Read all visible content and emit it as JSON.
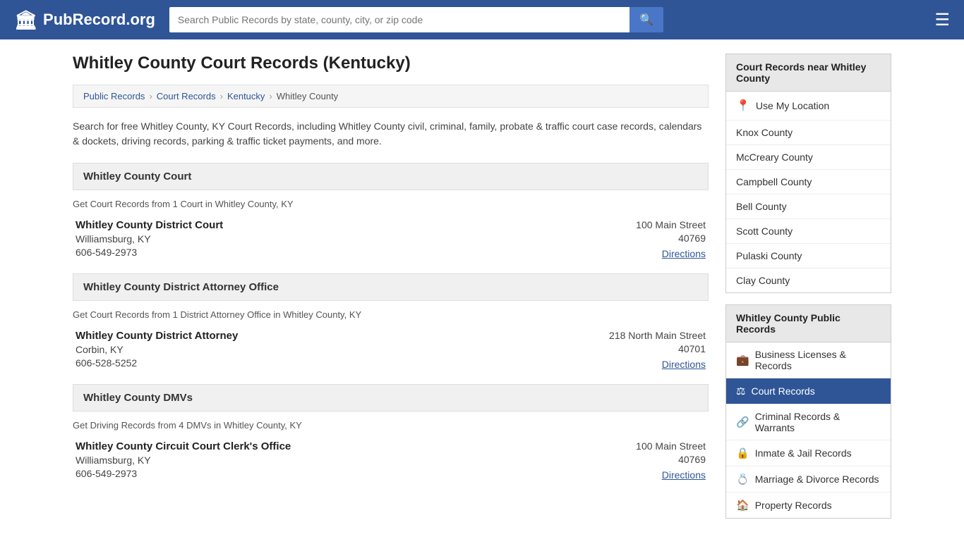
{
  "header": {
    "logo_icon": "🏛",
    "logo_text": "PubRecord.org",
    "search_placeholder": "Search Public Records by state, county, city, or zip code",
    "search_icon": "🔍",
    "menu_icon": "☰"
  },
  "page": {
    "title": "Whitley County Court Records (Kentucky)",
    "breadcrumbs": [
      "Public Records",
      "Court Records",
      "Kentucky",
      "Whitley County"
    ],
    "intro": "Search for free Whitley County, KY Court Records, including Whitley County civil, criminal, family, probate & traffic court case records, calendars & dockets, driving records, parking & traffic ticket payments, and more."
  },
  "sections": [
    {
      "id": "court",
      "header": "Whitley County Court",
      "desc": "Get Court Records from 1 Court in Whitley County, KY",
      "entries": [
        {
          "name": "Whitley County District Court",
          "city": "Williamsburg, KY",
          "phone": "606-549-2973",
          "address": "100 Main Street",
          "zip": "40769",
          "directions": "Directions"
        }
      ]
    },
    {
      "id": "district-attorney",
      "header": "Whitley County District Attorney Office",
      "desc": "Get Court Records from 1 District Attorney Office in Whitley County, KY",
      "entries": [
        {
          "name": "Whitley County District Attorney",
          "city": "Corbin, KY",
          "phone": "606-528-5252",
          "address": "218 North Main Street",
          "zip": "40701",
          "directions": "Directions"
        }
      ]
    },
    {
      "id": "dmv",
      "header": "Whitley County DMVs",
      "desc": "Get Driving Records from 4 DMVs in Whitley County, KY",
      "entries": [
        {
          "name": "Whitley County Circuit Court Clerk's Office",
          "city": "Williamsburg, KY",
          "phone": "606-549-2973",
          "address": "100 Main Street",
          "zip": "40769",
          "directions": "Directions"
        }
      ]
    }
  ],
  "sidebar": {
    "nearby_title": "Court Records near Whitley County",
    "use_location": "Use My Location",
    "nearby_counties": [
      "Knox County",
      "McCreary County",
      "Campbell County",
      "Bell County",
      "Scott County",
      "Pulaski County",
      "Clay County"
    ],
    "public_records_title": "Whitley County Public Records",
    "public_records_items": [
      {
        "label": "Business Licenses & Records",
        "icon": "💼",
        "active": false
      },
      {
        "label": "Court Records",
        "icon": "⚖",
        "active": true
      },
      {
        "label": "Criminal Records & Warrants",
        "icon": "🔗",
        "active": false
      },
      {
        "label": "Inmate & Jail Records",
        "icon": "🔒",
        "active": false
      },
      {
        "label": "Marriage & Divorce Records",
        "icon": "💍",
        "active": false
      },
      {
        "label": "Property Records",
        "icon": "🏠",
        "active": false
      }
    ]
  }
}
